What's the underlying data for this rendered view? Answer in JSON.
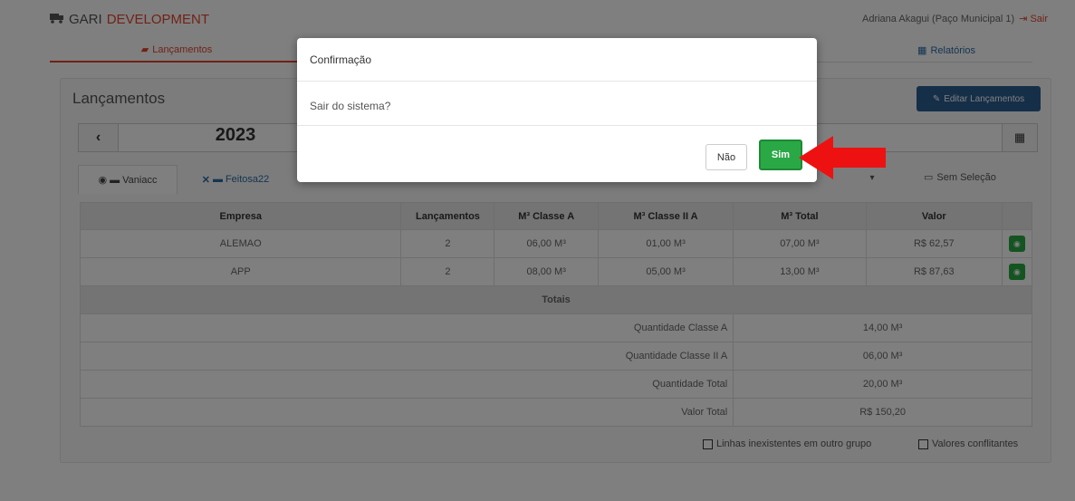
{
  "header": {
    "brand_first": "GARI",
    "brand_second": "DEVELOPMENT",
    "user": "Adriana Akagui (Paço Municipal 1)",
    "logout": "Sair"
  },
  "nav": {
    "tab_lancamentos": "Lançamentos",
    "tab_relatorios": "Relatórios"
  },
  "panel": {
    "title": "Lançamentos",
    "edit_button": "Editar Lançamentos",
    "year": "2023",
    "group_tab_1": "Vaniacc",
    "group_tab_2": "Feitosa22",
    "no_selection": "Sem Seleção"
  },
  "table": {
    "headers": [
      "Empresa",
      "Lançamentos",
      "M³ Classe A",
      "M³ Classe II A",
      "M³ Total",
      "Valor"
    ],
    "rows": [
      [
        "ALEMAO",
        "2",
        "06,00 M³",
        "01,00 M³",
        "07,00 M³",
        "R$ 62,57"
      ],
      [
        "APP",
        "2",
        "08,00 M³",
        "05,00 M³",
        "13,00 M³",
        "R$ 87,63"
      ]
    ],
    "totals_title": "Totais",
    "totals": [
      {
        "label": "Quantidade Classe A",
        "value": "14,00 M³"
      },
      {
        "label": "Quantidade Classe II A",
        "value": "06,00 M³"
      },
      {
        "label": "Quantidade Total",
        "value": "20,00 M³"
      },
      {
        "label": "Valor Total",
        "value": "R$ 150,20"
      }
    ]
  },
  "options": {
    "missing_lines": "Linhas inexistentes em outro grupo",
    "conflicting_values": "Valores conflitantes"
  },
  "modal": {
    "title": "Confirmação",
    "message": "Sair do sistema?",
    "no_button": "Não",
    "yes_button": "Sim"
  },
  "colors": {
    "brand_red": "#e2452f",
    "primary_blue": "#2d5f93",
    "success_green": "#2aa846",
    "arrow_red": "#ee1111"
  }
}
